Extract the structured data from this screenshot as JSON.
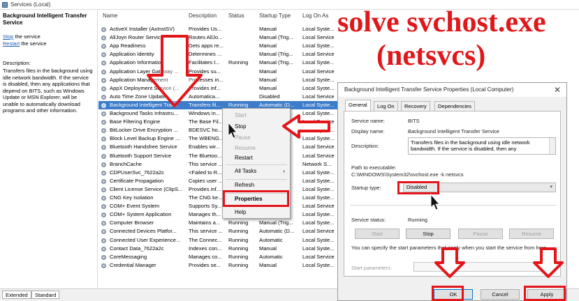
{
  "window": {
    "title": "Services (Local)"
  },
  "left_pane": {
    "service_title": "Background Intelligent Transfer Service",
    "stop_link": "Stop",
    "stop_suffix": " the service",
    "restart_link": "Restart",
    "restart_suffix": " the service",
    "description_label": "Description:",
    "description_text": "Transfers files in the background using idle network bandwidth. If the service is disabled, then any applications that depend on BITS, such as Windows Update or MSN Explorer, will be unable to automatically download programs and other information."
  },
  "columns": [
    "Name",
    "Description",
    "Status",
    "Startup Type",
    "Log On As"
  ],
  "services": [
    [
      "ActiveX Installer (AxInstSV)",
      "Provides Us...",
      "",
      "Manual",
      "Local Syste..."
    ],
    [
      "AllJoyn Router Service",
      "Routes AllJo...",
      "",
      "Manual (Trig...",
      "Local Service"
    ],
    [
      "App Readiness",
      "Gets apps re...",
      "",
      "Manual",
      "Local Syste..."
    ],
    [
      "Application Identity",
      "Determines ...",
      "",
      "Manual (Trig...",
      "Local Service"
    ],
    [
      "Application Information",
      "Facilitates t...",
      "Running",
      "Manual (Trig...",
      "Local Syste..."
    ],
    [
      "Application Layer Gateway ...",
      "Provides su...",
      "",
      "Manual",
      "Local Service"
    ],
    [
      "Application Management",
      "Processes in...",
      "",
      "Manual",
      "Local Syste..."
    ],
    [
      "AppX Deployment Service (...",
      "Provides inf...",
      "",
      "Manual",
      "Local Syste..."
    ],
    [
      "Auto Time Zone Updater",
      "Automatica...",
      "",
      "Disabled",
      "Local Service"
    ],
    [
      "Background Intelligent Tran...",
      "Transfers fil...",
      "Running",
      "Automatic (D...",
      "Local Syste..."
    ],
    [
      "Background Tasks Infrastru...",
      "Windows in...",
      "",
      "",
      "Local Syste..."
    ],
    [
      "Base Filtering Engine",
      "The Base Fil...",
      "",
      "",
      "Local Service"
    ],
    [
      "BitLocker Drive Encryption ...",
      "BDESVC ho...",
      "",
      "",
      "Local Syste..."
    ],
    [
      "Block Level Backup Engine ...",
      "The WBENG...",
      "",
      "",
      "Local Syste..."
    ],
    [
      "Bluetooth Handsfree Service",
      "Enables wir...",
      "",
      "",
      "Local Service"
    ],
    [
      "Bluetooth Support Service",
      "The Bluetoo...",
      "",
      "",
      "Local Service"
    ],
    [
      "BranchCache",
      "This service ...",
      "",
      "",
      "Network S..."
    ],
    [
      "CDPUserSvc_7622a2c",
      "<Failed to R...",
      "",
      "",
      "Local Syste..."
    ],
    [
      "Certificate Propagation",
      "Copies user ...",
      "",
      "",
      "Local Syste..."
    ],
    [
      "Client License Service (ClipS...",
      "Provides inf...",
      "",
      "",
      "Local Syste..."
    ],
    [
      "CNG Key Isolation",
      "The CNG ke...",
      "",
      "",
      "Local Syste..."
    ],
    [
      "COM+ Event System",
      "Supports Sy...",
      "",
      "",
      "Local Service"
    ],
    [
      "COM+ System Application",
      "Manages th...",
      "",
      "Manual",
      "Local Syste..."
    ],
    [
      "Computer Browser",
      "Maintains a...",
      "Running",
      "Manual (Trig...",
      "Local Syste..."
    ],
    [
      "Connected Devices Platfor...",
      "This service ...",
      "Running",
      "Automatic (D...",
      "Local Service"
    ],
    [
      "Connected User Experience...",
      "The Connec...",
      "Running",
      "Automatic",
      "Local Syste..."
    ],
    [
      "Contact Data_7622a2c",
      "Indexes con...",
      "Running",
      "Manual",
      "Local Syste..."
    ],
    [
      "CoreMessaging",
      "Manages co...",
      "Running",
      "Automatic",
      "Local Service"
    ],
    [
      "Credential Manager",
      "Provides se...",
      "Running",
      "Manual",
      "Local Syste..."
    ]
  ],
  "bottom_tabs": [
    "Extended",
    "Standard"
  ],
  "context_menu": {
    "items": [
      "Start",
      "Stop",
      "Pause",
      "Resume",
      "Restart",
      "All Tasks",
      "Refresh",
      "Properties",
      "Help"
    ],
    "submenu_arrow": "›"
  },
  "dialog": {
    "title": "Background Intelligent Transfer Service Properties (Local Computer)",
    "close": "✕",
    "tabs": [
      "General",
      "Log On",
      "Recovery",
      "Dependencies"
    ],
    "service_name_label": "Service name:",
    "service_name": "BITS",
    "display_name_label": "Display name:",
    "display_name": "Background Intelligent Transfer Service",
    "description_label": "Description:",
    "description": "Transfers files in the background using idle network bandwidth. If the service is disabled, then any",
    "path_label": "Path to executable:",
    "path": "C:\\WINDOWS\\System32\\svchost.exe -k netsvcs",
    "startup_type_label": "Startup type:",
    "startup_type": "Disabled",
    "service_status_label": "Service status:",
    "service_status": "Running",
    "buttons": {
      "start": "Start",
      "stop": "Stop",
      "pause": "Pause",
      "resume": "Resume"
    },
    "start_params_note": "You can specify the start parameters that apply when you start the service from here.",
    "start_params_label": "Start parameters:",
    "ok": "OK",
    "cancel": "Cancel",
    "apply": "Apply"
  },
  "overlay": {
    "headline_line1": "solve svchost.exe",
    "headline_line2": "(netsvcs)",
    "accent_color": "#e3151b"
  }
}
